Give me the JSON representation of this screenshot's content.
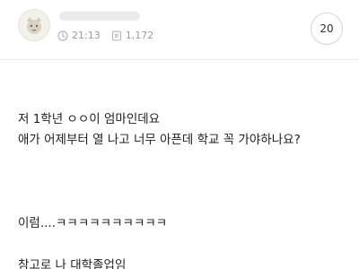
{
  "post": {
    "time": "21:13",
    "views": "1,172",
    "comment_count": "20",
    "icons": {
      "time": "clock-icon",
      "views": "document-icon"
    }
  },
  "content": {
    "lines": [
      "저 1학년 ㅇㅇ이 엄마인데요",
      "애가 어제부터 열 나고 너무 아픈데 학교 꼭 가야하나요?",
      "이럼....ㅋㅋㅋㅋㅋㅋㅋㅋㅋㅋ",
      "참고로 나 대학졸업임"
    ]
  }
}
